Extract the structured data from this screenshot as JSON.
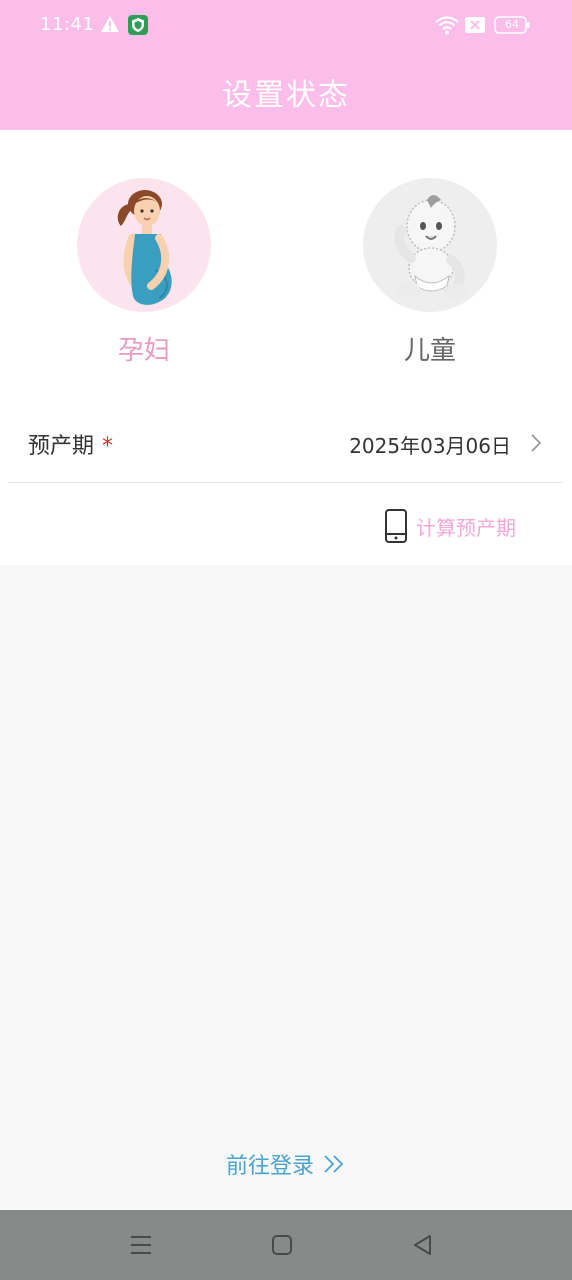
{
  "status_bar": {
    "time": "11:41",
    "battery": "64",
    "icons": [
      "warning-icon",
      "shield-icon",
      "wifi-icon",
      "sim-icon",
      "battery-icon"
    ]
  },
  "header": {
    "title": "设置状态"
  },
  "roles": [
    {
      "label": "孕妇",
      "selected": true,
      "icon": "pregnant-woman-avatar"
    },
    {
      "label": "儿童",
      "selected": false,
      "icon": "baby-avatar"
    }
  ],
  "due_date": {
    "label": "预产期",
    "required_mark": "*",
    "value": "2025年03月06日"
  },
  "calc": {
    "label": "计算预产期",
    "icon": "phone-icon"
  },
  "login": {
    "label": "前往登录",
    "icon": "double-chevron-right-icon"
  },
  "colors": {
    "header_bg": "#fbbde9",
    "accent_pink": "#e89ac4",
    "link_blue": "#4aa3cf",
    "nav_bg": "#868a89"
  }
}
